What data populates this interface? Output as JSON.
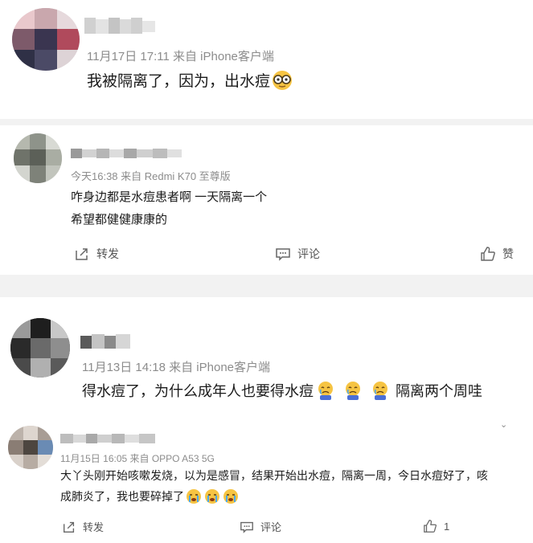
{
  "posts": [
    {
      "meta": "11月17日 17:11  来自 iPhone客户端",
      "text": "我被隔离了，因为，出水痘",
      "emoji_icon": "glasses-face-icon"
    },
    {
      "meta": "今天16:38  来自 Redmi K70 至尊版",
      "lines": [
        "咋身边都是水痘患者啊 一天隔离一个",
        "希望都健健康康的"
      ],
      "actions": {
        "repost": "转发",
        "comment": "评论",
        "like": "赞"
      }
    },
    {
      "meta": "11月13日 14:18  来自 iPhone客户端",
      "text_a": "得水痘了，为什么成年人也要得水痘",
      "text_b": "隔离两个周哇",
      "emoji_icon": "crying-face-icon"
    },
    {
      "meta": "11月15日 16:05  来自 OPPO A53 5G",
      "line1": "大丫头刚开始咳嗽发烧，以为是感冒，结果开始出水痘，隔离一周，今日水痘好了，咳",
      "line2": "成肺炎了，我也要碎掉了",
      "emoji_icon": "tears-face-icon",
      "actions": {
        "repost": "转发",
        "comment": "评论",
        "like_count": "1"
      }
    }
  ],
  "colors": {
    "text": "#1b1b1b",
    "meta": "#8c8c8c",
    "divider": "#f2f2f2",
    "icon": "#666666"
  }
}
